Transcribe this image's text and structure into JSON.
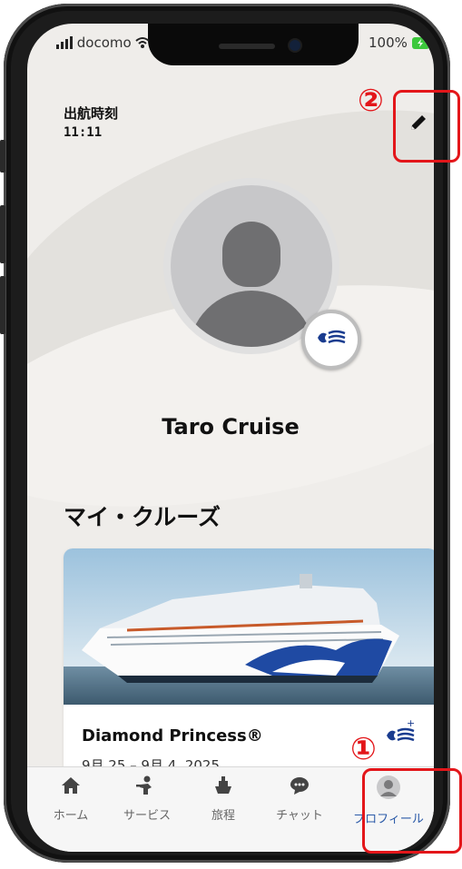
{
  "status_bar": {
    "carrier": "docomo",
    "battery": "100%"
  },
  "header": {
    "departure_label": "出航時刻",
    "departure_time": "11:11"
  },
  "edit_button": {
    "icon": "pencil-icon"
  },
  "profile": {
    "name": "Taro Cruise"
  },
  "my_cruises": {
    "title": "マイ・クルーズ",
    "card": {
      "ship_name": "Diamond Princess®",
      "dates": "9月 25 – 9月 4, 2025"
    }
  },
  "tabs": [
    {
      "label": "ホーム",
      "icon": "home-icon"
    },
    {
      "label": "サービス",
      "icon": "service-icon"
    },
    {
      "label": "旅程",
      "icon": "ship-icon"
    },
    {
      "label": "チャット",
      "icon": "chat-icon"
    },
    {
      "label": "プロフィール",
      "icon": "profile-icon",
      "active": true
    }
  ],
  "annotations": {
    "marker_1": "①",
    "marker_2": "②"
  },
  "colors": {
    "accent": "#e3161a",
    "active_tab": "#2b5aa8",
    "screen_bg": "#efedea"
  }
}
